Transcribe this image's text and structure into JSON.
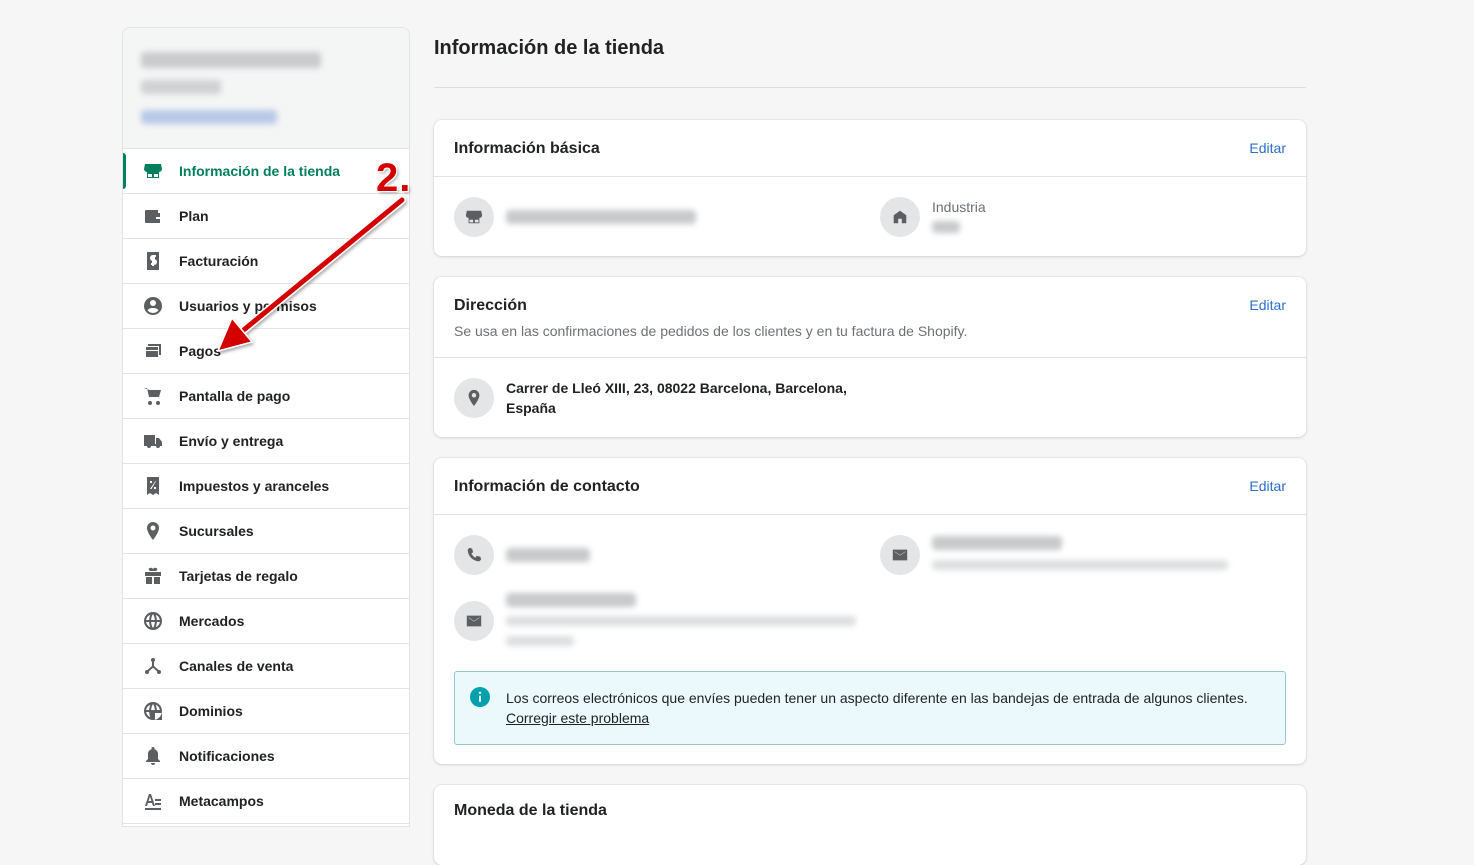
{
  "sidebar": {
    "items": [
      {
        "label": "Información de la tienda",
        "icon": "store-icon",
        "active": true
      },
      {
        "label": "Plan",
        "icon": "wallet-icon"
      },
      {
        "label": "Facturación",
        "icon": "billing-icon"
      },
      {
        "label": "Usuarios y permisos",
        "icon": "user-icon"
      },
      {
        "label": "Pagos",
        "icon": "payments-icon"
      },
      {
        "label": "Pantalla de pago",
        "icon": "cart-icon"
      },
      {
        "label": "Envío y entrega",
        "icon": "truck-icon"
      },
      {
        "label": "Impuestos y aranceles",
        "icon": "tax-icon"
      },
      {
        "label": "Sucursales",
        "icon": "location-icon"
      },
      {
        "label": "Tarjetas de regalo",
        "icon": "gift-icon"
      },
      {
        "label": "Mercados",
        "icon": "globe-icon"
      },
      {
        "label": "Canales de venta",
        "icon": "channels-icon"
      },
      {
        "label": "Dominios",
        "icon": "domain-icon"
      },
      {
        "label": "Notificaciones",
        "icon": "bell-icon"
      },
      {
        "label": "Metacampos",
        "icon": "metafields-icon"
      }
    ]
  },
  "page": {
    "title": "Información de la tienda"
  },
  "basic": {
    "title": "Información básica",
    "edit": "Editar",
    "industry_label": "Industria"
  },
  "address": {
    "title": "Dirección",
    "edit": "Editar",
    "subtitle": "Se usa en las confirmaciones de pedidos de los clientes y en tu factura de Shopify.",
    "line1": "Carrer de Lleó XIII, 23, 08022 Barcelona, Barcelona,",
    "line2": "España"
  },
  "contact": {
    "title": "Información de contacto",
    "edit": "Editar",
    "notice_text": "Los correos electrónicos que envíes pueden tener un aspecto diferente en las bandejas de entrada de algunos clientes.",
    "notice_link": "Corregir este problema"
  },
  "currency": {
    "title": "Moneda de la tienda"
  },
  "annotation": {
    "label": "2."
  },
  "colors": {
    "accent": "#008060",
    "link": "#2c6ecb",
    "annotation": "#d40000",
    "notice_bg": "#ebf9fc"
  }
}
